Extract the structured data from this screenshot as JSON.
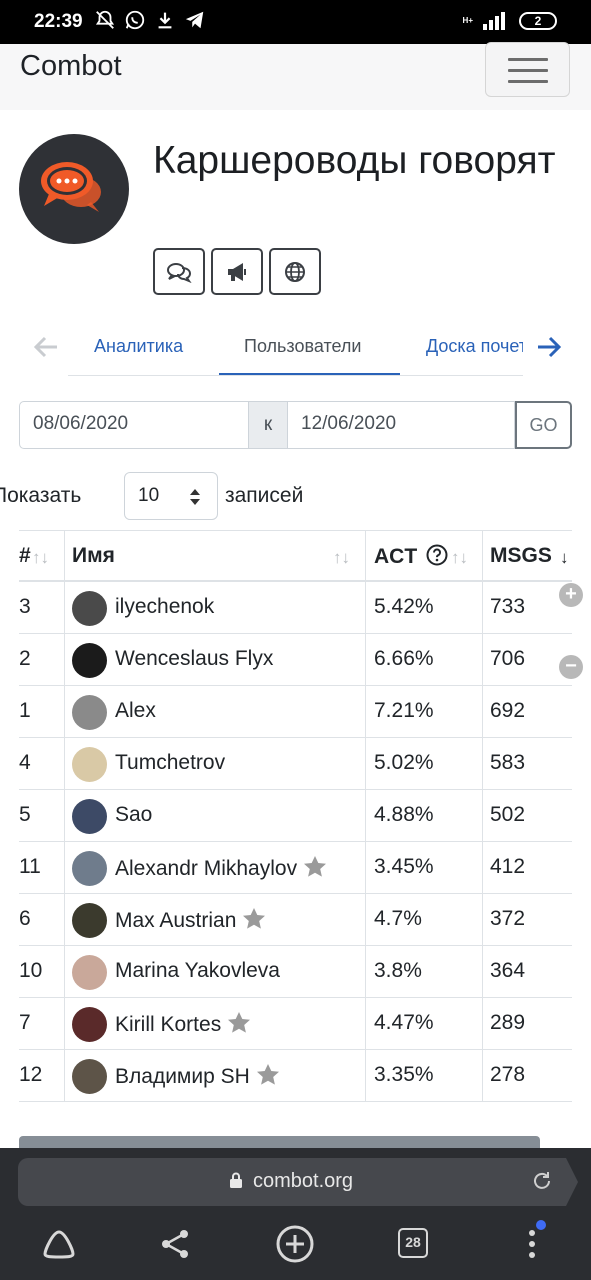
{
  "status_bar": {
    "time": "22:39",
    "network": "H+",
    "battery": "2"
  },
  "navbar": {
    "brand": "Combot"
  },
  "chat": {
    "title": "Каршероводы говорят"
  },
  "tabs": [
    {
      "label": "Аналитика",
      "active": false
    },
    {
      "label": "Пользователи",
      "active": true
    },
    {
      "label": "Доска почета",
      "active": false
    }
  ],
  "daterange": {
    "from": "08/06/2020",
    "separator": "к",
    "to": "12/06/2020",
    "go_label": "GO"
  },
  "show_entries": {
    "prefix": "Показать",
    "value": "10",
    "suffix": "записей"
  },
  "table": {
    "columns": {
      "num": "#",
      "name": "Имя",
      "act": "ACT",
      "msgs": "MSGS"
    },
    "rows": [
      {
        "num": "3",
        "name": "ilyechenok",
        "act": "5.42%",
        "msgs": "733",
        "star": false,
        "avatar_color": "#4a4a4a"
      },
      {
        "num": "2",
        "name": "Wenceslaus Flyx",
        "act": "6.66%",
        "msgs": "706",
        "star": false,
        "avatar_color": "#1b1b1b"
      },
      {
        "num": "1",
        "name": "Alex",
        "act": "7.21%",
        "msgs": "692",
        "star": false,
        "avatar_color": "#8a8a8a"
      },
      {
        "num": "4",
        "name": "Tumchetrov",
        "act": "5.02%",
        "msgs": "583",
        "star": false,
        "avatar_color": "#d9c9a6"
      },
      {
        "num": "5",
        "name": "Sao",
        "act": "4.88%",
        "msgs": "502",
        "star": false,
        "avatar_color": "#3d4a66"
      },
      {
        "num": "11",
        "name": "Alexandr Mikhaylov",
        "act": "3.45%",
        "msgs": "412",
        "star": true,
        "avatar_color": "#6f7c8c"
      },
      {
        "num": "6",
        "name": "Max Austrian",
        "act": "4.7%",
        "msgs": "372",
        "star": true,
        "avatar_color": "#3b3a2d"
      },
      {
        "num": "10",
        "name": "Marina Yakovleva",
        "act": "3.8%",
        "msgs": "364",
        "star": false,
        "avatar_color": "#c9a89a"
      },
      {
        "num": "7",
        "name": "Kirill Kortes",
        "act": "4.47%",
        "msgs": "289",
        "star": true,
        "avatar_color": "#5a2a2a"
      },
      {
        "num": "12",
        "name": "Владимир SH",
        "act": "3.35%",
        "msgs": "278",
        "star": true,
        "avatar_color": "#5d5448"
      }
    ]
  },
  "browser": {
    "url": "combot.org",
    "tab_count": "28"
  },
  "colors": {
    "link": "#2a62b8",
    "star": "#9a9a9a",
    "browser_bg": "#2b2d31",
    "accent_orange": "#f05a28"
  },
  "icons": [
    "silent-alarm-icon",
    "whatsapp-icon",
    "download-icon",
    "telegram-icon",
    "chat-icon",
    "megaphone-icon",
    "globe-icon",
    "arrow-left-icon",
    "arrow-right-icon",
    "question-circle-icon",
    "sort-icon",
    "star-icon",
    "plus-circle-icon",
    "minus-circle-icon",
    "lock-icon",
    "reload-icon",
    "home-icon",
    "share-icon",
    "new-tab-icon",
    "tabs-icon",
    "menu-dots-icon"
  ]
}
